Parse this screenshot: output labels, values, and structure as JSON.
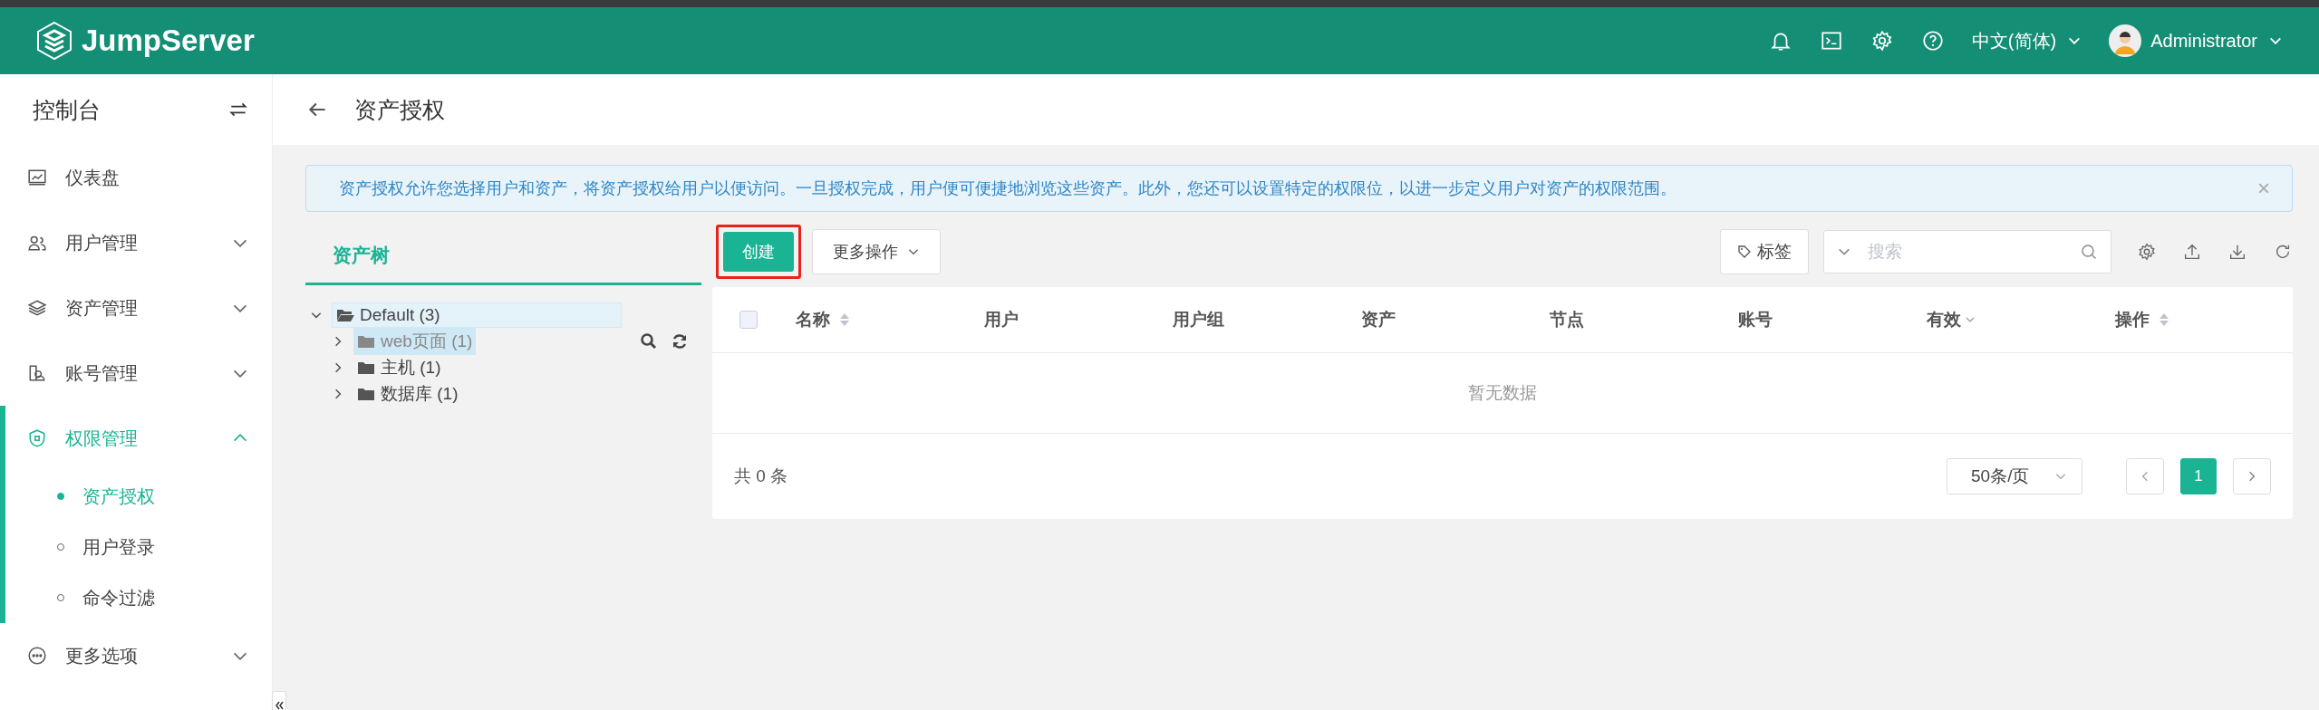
{
  "header": {
    "logo": "JumpServer",
    "language": "中文(简体)",
    "user": "Administrator"
  },
  "sidebar": {
    "title": "控制台",
    "items": [
      {
        "label": "仪表盘",
        "expandable": false,
        "selected": false
      },
      {
        "label": "用户管理",
        "expandable": true,
        "expanded": false,
        "selected": false
      },
      {
        "label": "资产管理",
        "expandable": true,
        "expanded": false,
        "selected": false
      },
      {
        "label": "账号管理",
        "expandable": true,
        "expanded": false,
        "selected": false
      },
      {
        "label": "权限管理",
        "expandable": true,
        "expanded": true,
        "selected": true,
        "children": [
          {
            "label": "资产授权",
            "selected": true
          },
          {
            "label": "用户登录",
            "selected": false
          },
          {
            "label": "命令过滤",
            "selected": false
          }
        ]
      },
      {
        "label": "更多选项",
        "expandable": true,
        "expanded": false,
        "selected": false
      }
    ]
  },
  "page": {
    "title": "资产授权"
  },
  "alert": {
    "text": "资产授权允许您选择用户和资产，将资产授权给用户以便访问。一旦授权完成，用户便可便捷地浏览这些资产。此外，您还可以设置特定的权限位，以进一步定义用户对资产的权限范围。",
    "close": "×"
  },
  "tree": {
    "tab": "资产树",
    "nodes": [
      {
        "label": "Default (3)",
        "expanded": true,
        "selected": false,
        "children": [
          {
            "label": "web页面 (1)",
            "expanded": false,
            "selected": true
          },
          {
            "label": "主机 (1)",
            "expanded": false,
            "selected": false
          },
          {
            "label": "数据库 (1)",
            "expanded": false,
            "selected": false
          }
        ]
      }
    ]
  },
  "toolbar": {
    "create": {
      "label": "创建",
      "annotated": true
    },
    "more": "更多操作",
    "tag": "标签",
    "search": {
      "placeholder": "搜索"
    }
  },
  "table": {
    "columns": [
      {
        "label": "名称",
        "kind": "sort"
      },
      {
        "label": "用户",
        "kind": "plain"
      },
      {
        "label": "用户组",
        "kind": "plain"
      },
      {
        "label": "资产",
        "kind": "plain"
      },
      {
        "label": "节点",
        "kind": "plain"
      },
      {
        "label": "账号",
        "kind": "plain"
      },
      {
        "label": "有效",
        "kind": "filter"
      },
      {
        "label": "操作",
        "kind": "sort"
      }
    ],
    "select_all": {
      "checked": false
    },
    "empty": "暂无数据"
  },
  "pagination": {
    "total": "共 0 条",
    "page_size": "50条/页",
    "pages": [
      {
        "label": "1",
        "selected": true
      }
    ]
  }
}
